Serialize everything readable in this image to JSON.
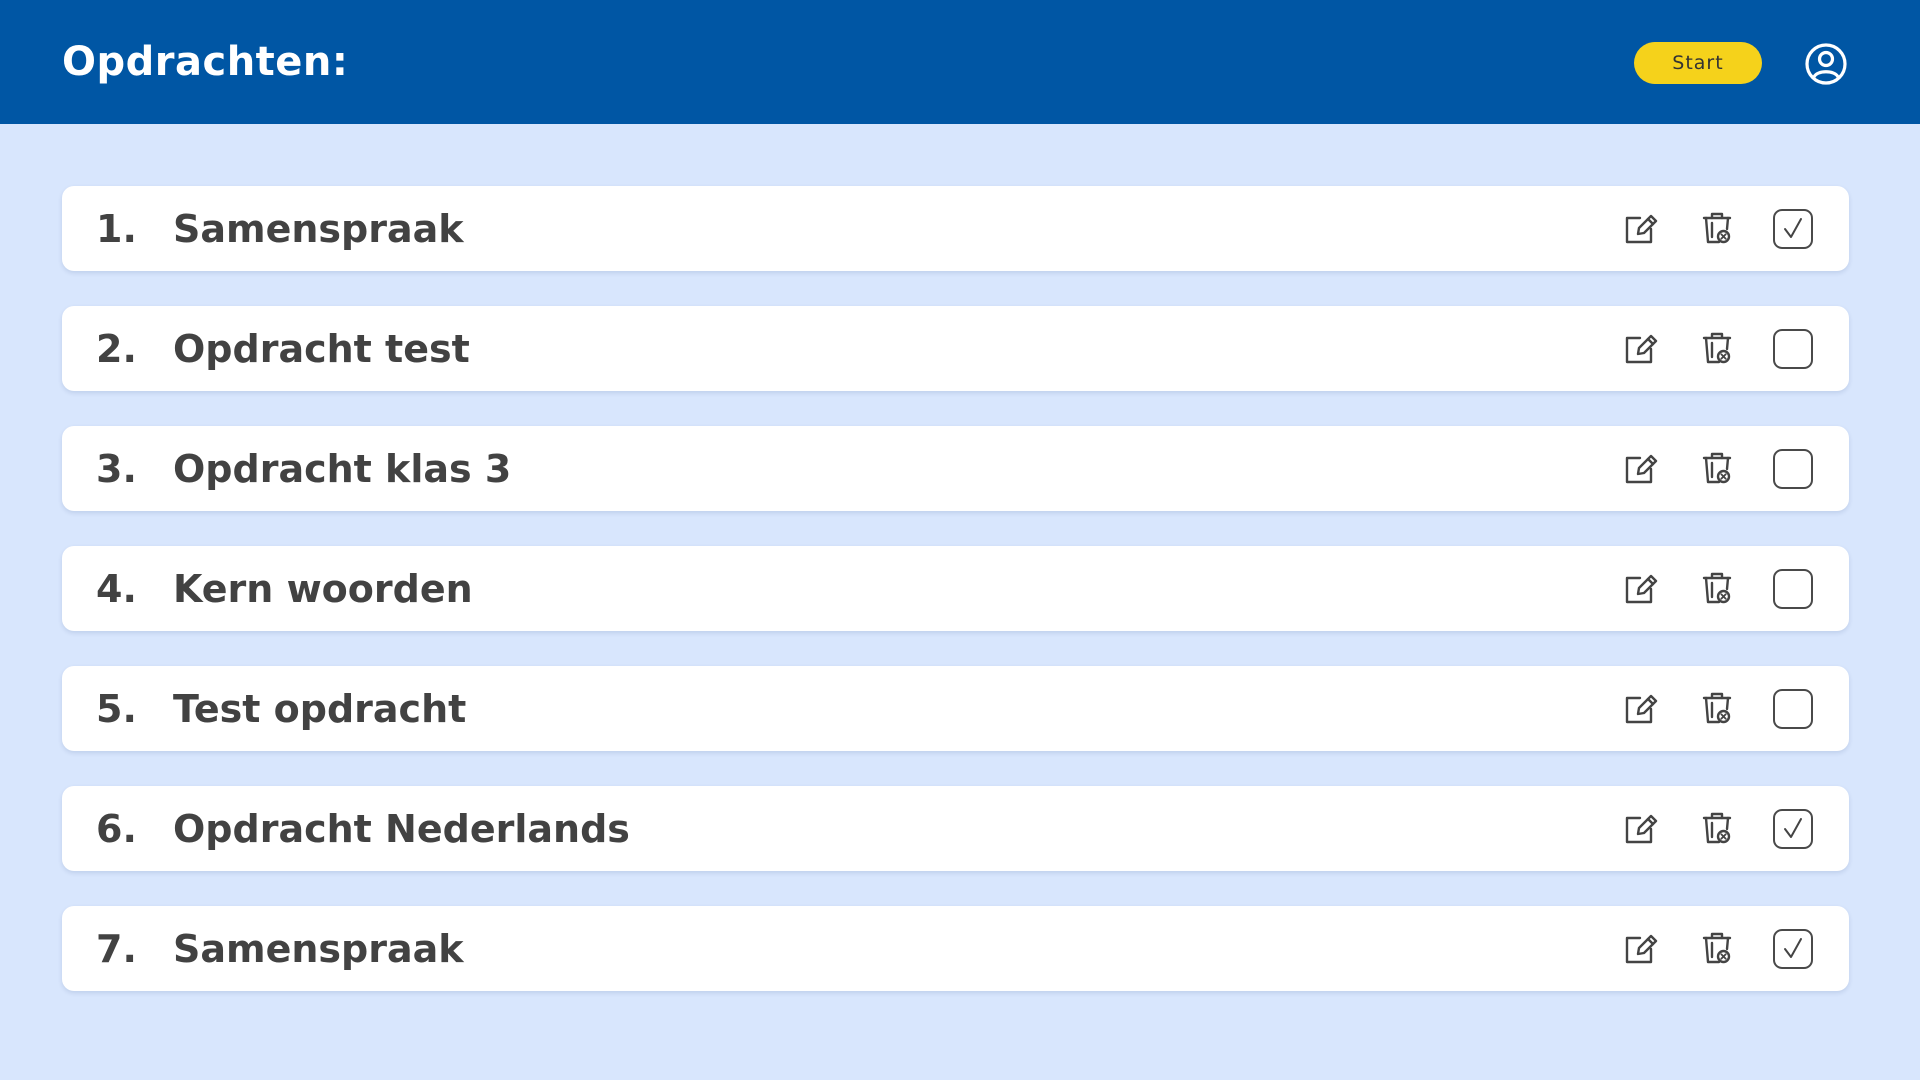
{
  "header": {
    "title": "Opdrachten:",
    "start_label": "Start",
    "profile_icon": "user-circle-icon"
  },
  "colors": {
    "header_bg": "#0056a4",
    "page_bg": "#d8e6fd",
    "start_button": "#f5d21b",
    "text": "#424242"
  },
  "assignments": [
    {
      "number": "1.",
      "title": "Samenspraak",
      "checked": true
    },
    {
      "number": "2.",
      "title": "Opdracht test",
      "checked": false
    },
    {
      "number": "3.",
      "title": "Opdracht klas 3",
      "checked": false
    },
    {
      "number": "4.",
      "title": "Kern woorden",
      "checked": false
    },
    {
      "number": "5.",
      "title": "Test opdracht",
      "checked": false
    },
    {
      "number": "6.",
      "title": "Opdracht Nederlands",
      "checked": true
    },
    {
      "number": "7.",
      "title": "Samenspraak",
      "checked": true
    }
  ],
  "row_icons": [
    "edit-icon",
    "trash-icon",
    "checkbox-icon"
  ]
}
